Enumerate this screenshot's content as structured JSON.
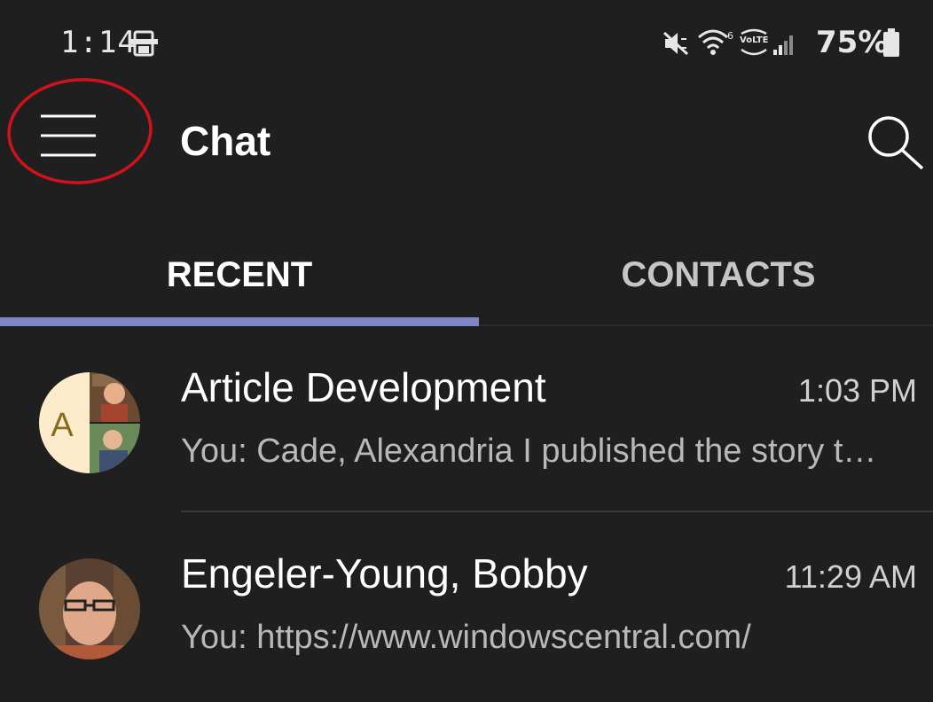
{
  "status_bar": {
    "time": "1:14",
    "battery_percent": "75%",
    "icons": [
      "screenshot-icon",
      "mute-icon",
      "wifi-icon",
      "volte-icon",
      "signal-icon",
      "battery-icon"
    ],
    "wifi_label": "6",
    "volte_label": "VoLTE"
  },
  "header": {
    "title": "Chat",
    "menu_icon": "hamburger-menu-icon",
    "search_icon": "search-icon",
    "annotation_color": "#d0121b"
  },
  "tabs": [
    {
      "label": "RECENT",
      "active": true
    },
    {
      "label": "CONTACTS",
      "active": false
    }
  ],
  "accent_color": "#7f85c2",
  "chats": [
    {
      "name": "Article Development",
      "time": "1:03 PM",
      "preview": "You: Cade, Alexandria I published the story today.",
      "avatar_letter": "A",
      "avatar_type": "group"
    },
    {
      "name": "Engeler-Young, Bobby",
      "time": "11:29 AM",
      "preview": "You: https://www.windowscentral.com/",
      "avatar_type": "photo"
    }
  ]
}
